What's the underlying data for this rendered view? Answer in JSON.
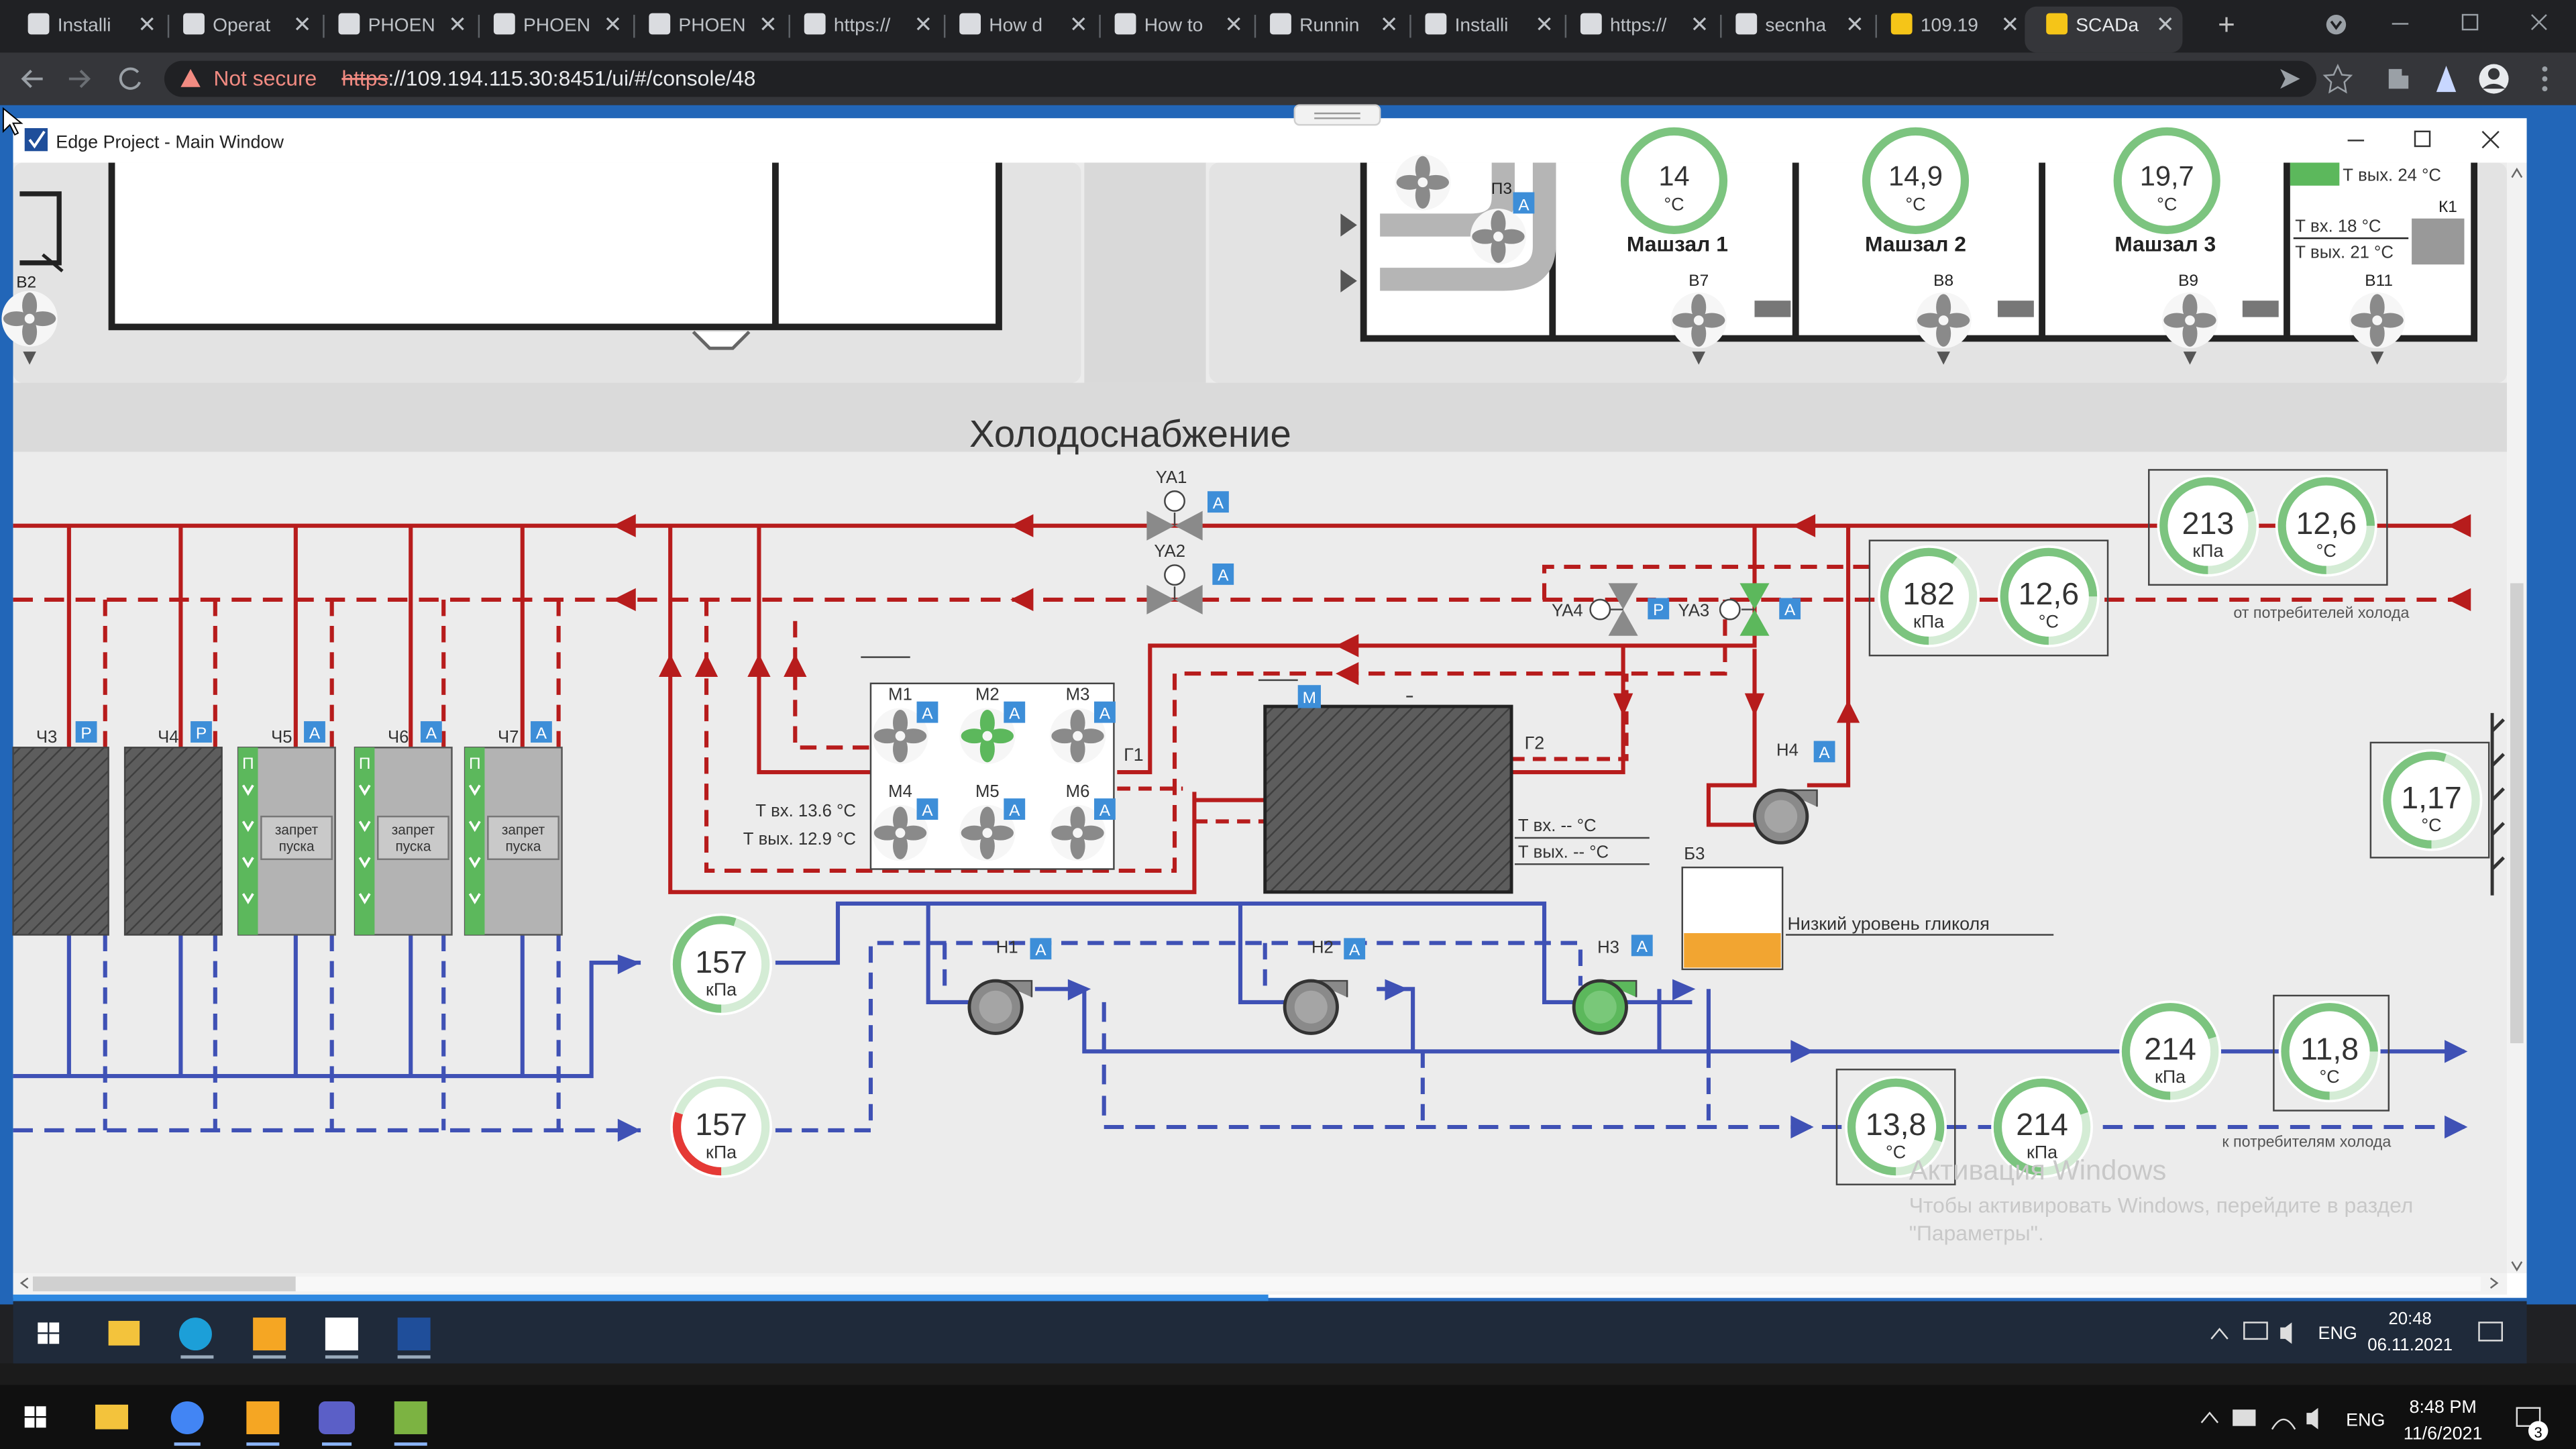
{
  "browser": {
    "tabs": [
      {
        "label": "Installi",
        "icon": "wifi-icon"
      },
      {
        "label": "Operat",
        "icon": "phoenix-icon"
      },
      {
        "label": "PHOEN",
        "icon": "phoenix-icon"
      },
      {
        "label": "PHOEN",
        "icon": "phoenix-icon"
      },
      {
        "label": "PHOEN",
        "icon": "phoenix-icon"
      },
      {
        "label": "https://",
        "icon": "phoenix-icon"
      },
      {
        "label": "How d",
        "icon": "phoenix-icon"
      },
      {
        "label": "How to",
        "icon": "globe-icon"
      },
      {
        "label": "Runnin",
        "icon": "phoenix-icon"
      },
      {
        "label": "Installi",
        "icon": "arrow-circle-icon"
      },
      {
        "label": "https://",
        "icon": "globe-icon"
      },
      {
        "label": "secnha",
        "icon": "doc-icon"
      },
      {
        "label": "109.19",
        "icon": "scada-icon"
      },
      {
        "label": "SCADa",
        "icon": "scada-icon"
      }
    ],
    "new_tab": "+",
    "not_secure": "Not secure",
    "url_scheme": "https",
    "url_rest": "://109.194.115.30:8451/ui/#/console/48"
  },
  "window": {
    "title": "Edge Project - Main Window"
  },
  "hvac": {
    "labels": [
      "П3",
      "Машзал 1",
      "Машзал 2",
      "Машзал 3",
      "В2",
      "В7",
      "В8",
      "В9",
      "В11",
      "К1"
    ],
    "temps": [
      "14",
      "14,9",
      "19,7"
    ],
    "unit_c": "°C",
    "k1_tout_top": "Т вых. 24 °С",
    "k1_tin": "Т вх. 18 °С",
    "k1_tout": "Т вых. 21 °С"
  },
  "section": {
    "title": "Холодоснабжение"
  },
  "cold": {
    "valves": [
      "YA1",
      "YA2",
      "YA4",
      "YA3"
    ],
    "modes": [
      "A",
      "A",
      "P",
      "A"
    ],
    "chillers": [
      "Ч3",
      "Ч4",
      "Ч5",
      "Ч6",
      "Ч7"
    ],
    "chiller_modes": [
      "P",
      "P",
      "A",
      "A",
      "A"
    ],
    "start_ban": "запрет пуска",
    "p_letter": "П",
    "fans": [
      "М1",
      "М2",
      "М3",
      "М4",
      "М5",
      "М6"
    ],
    "g1": "Г1",
    "g2": "Г2",
    "b3": "Б3",
    "mode_m": "M",
    "mode_a": "A",
    "dry_tin": "Т вх. 13.6 °С",
    "dry_tout": "Т вых. 12.9 °С",
    "hx_tin": "Т вх. -- °С",
    "hx_tout": "Т вых. -- °С",
    "pumps": [
      "Н1",
      "Н2",
      "Н3",
      "Н4"
    ],
    "glycol": "Низкий уровень гликоля",
    "from_consumers": "от потребителей холода",
    "to_consumers": "к потребителям холода",
    "unit_kpa": "кПа",
    "unit_c": "°C"
  },
  "gauges": [
    {
      "value": "213",
      "unit": "кПа",
      "fill": 0.7,
      "color": "#7cc47f"
    },
    {
      "value": "12,6",
      "unit": "°C",
      "fill": 0.75,
      "color": "#7cc47f"
    },
    {
      "value": "182",
      "unit": "кПа",
      "fill": 0.6,
      "color": "#7cc47f"
    },
    {
      "value": "12,6",
      "unit": "°C",
      "fill": 0.75,
      "color": "#7cc47f"
    },
    {
      "value": "1,17",
      "unit": "°C",
      "fill": 0.55,
      "color": "#7cc47f"
    },
    {
      "value": "157",
      "unit": "кПа",
      "fill": 0.55,
      "color": "#7cc47f"
    },
    {
      "value": "157",
      "unit": "кПа",
      "fill": 0.3,
      "color": "#e53935"
    },
    {
      "value": "214",
      "unit": "кПа",
      "fill": 0.7,
      "color": "#7cc47f"
    },
    {
      "value": "11,8",
      "unit": "°C",
      "fill": 0.75,
      "color": "#7cc47f"
    },
    {
      "value": "13,8",
      "unit": "°C",
      "fill": 0.8,
      "color": "#7cc47f"
    },
    {
      "value": "214",
      "unit": "кПа",
      "fill": 0.7,
      "color": "#7cc47f"
    }
  ],
  "watermark": {
    "line1": "Активация Windows",
    "line2": "Чтобы активировать Windows, перейдите в раздел",
    "line3": "\"Параметры\"."
  },
  "vm_taskbar": {
    "lang": "ENG",
    "time": "20:48",
    "date": "06.11.2021"
  },
  "host_taskbar": {
    "lang": "ENG",
    "time": "8:48 PM",
    "date": "11/6/2021",
    "badge": "3"
  },
  "colors": {
    "hot": "#b71c1c",
    "cold": "#3f51b5",
    "gauge_ok": "#7cc47f",
    "mode_badge": "#3d8ed8",
    "panel": "#ececec"
  }
}
